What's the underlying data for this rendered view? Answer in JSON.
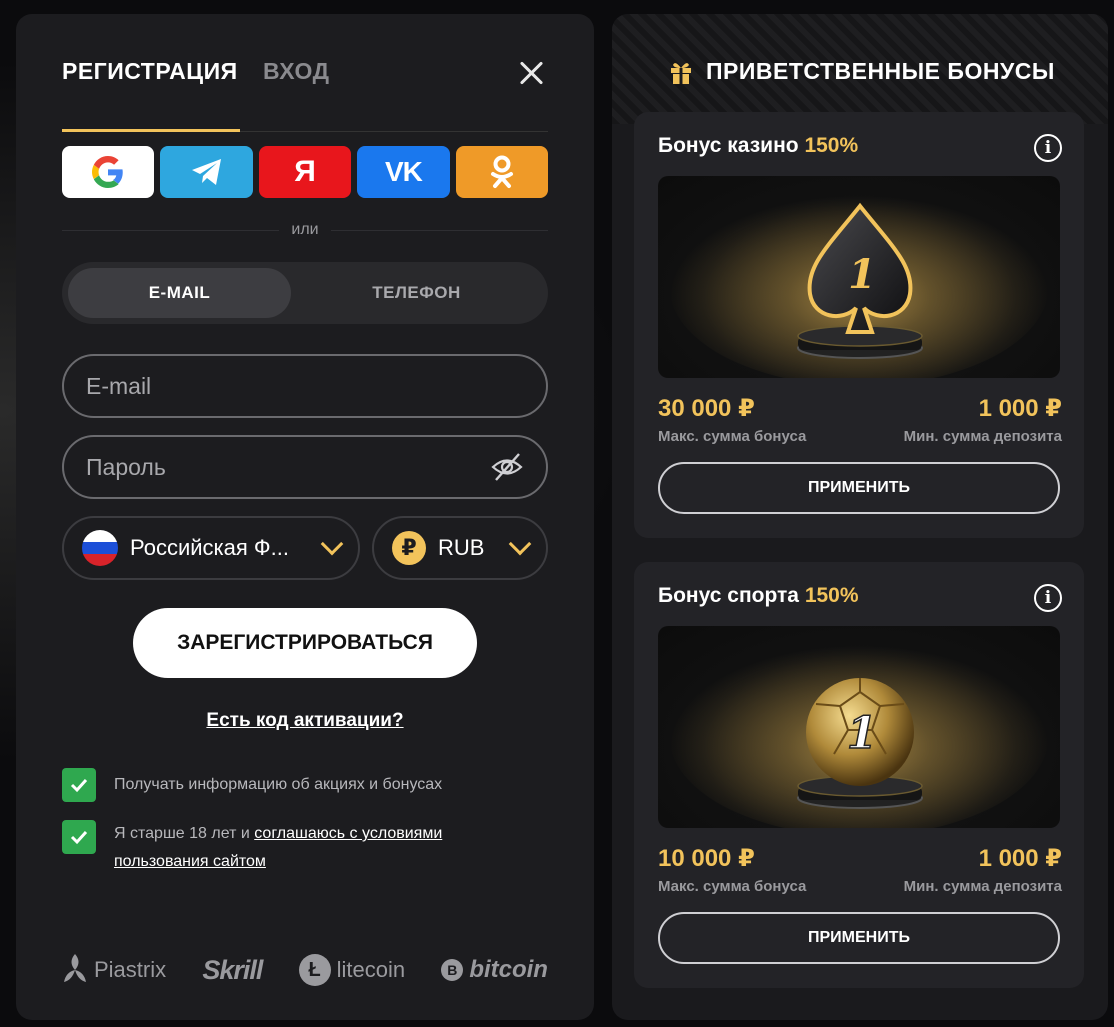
{
  "registration": {
    "tab_register": "РЕГИСТРАЦИЯ",
    "tab_login": "ВХОД",
    "or_text": "или",
    "segment_email": "E-MAIL",
    "segment_phone": "ТЕЛЕФОН",
    "email_placeholder": "E-mail",
    "password_placeholder": "Пароль",
    "country_value": "Российская Ф...",
    "currency_value": "RUB",
    "currency_symbol": "₽",
    "submit_label": "ЗАРЕГИСТРИРОВАТЬСЯ",
    "activation_link": "Есть код активации?",
    "consent_promo": "Получать информацию об акциях и бонусах",
    "consent_age_prefix": "Я старше 18 лет и ",
    "consent_age_link": "соглашаюсь с условиями пользования сайтом",
    "social_yandex": "Я",
    "social_vk": "VK",
    "payments": {
      "piastrix": "Piastrix",
      "skrill": "Skrill",
      "litecoin": "litecoin",
      "litecoin_mark": "Ł",
      "bitcoin": "bitcoin",
      "bitcoin_mark": "B"
    }
  },
  "bonuses": {
    "heading": "ПРИВЕТСТВЕННЫЕ БОНУСЫ",
    "cards": [
      {
        "title": "Бонус казино",
        "percent": "150%",
        "max_amount": "30 000 ₽",
        "max_label": "Макс. сумма бонуса",
        "min_amount": "1 000 ₽",
        "min_label": "Мин. сумма депозита",
        "apply_label": "ПРИМЕНИТЬ",
        "badge": "1"
      },
      {
        "title": "Бонус спорта",
        "percent": "150%",
        "max_amount": "10 000 ₽",
        "max_label": "Макс. сумма бонуса",
        "min_amount": "1 000 ₽",
        "min_label": "Мин. сумма депозита",
        "apply_label": "ПРИМЕНИТЬ",
        "badge": "1"
      }
    ],
    "info_symbol": "i"
  },
  "colors": {
    "accent": "#f2c35b",
    "checkbox": "#2fa84f",
    "google": "#ffffff",
    "telegram": "#2ea7df",
    "yandex": "#e8161c",
    "vk": "#1a78ee",
    "ok": "#ef9a28"
  },
  "icons": [
    "close-icon",
    "google-icon",
    "telegram-icon",
    "yandex-icon",
    "vk-icon",
    "ok-icon",
    "eye-off-icon",
    "russia-flag-icon",
    "ruble-icon",
    "chevron-down-icon",
    "check-icon",
    "gift-icon",
    "info-icon",
    "spade-trophy-icon",
    "football-trophy-icon"
  ]
}
